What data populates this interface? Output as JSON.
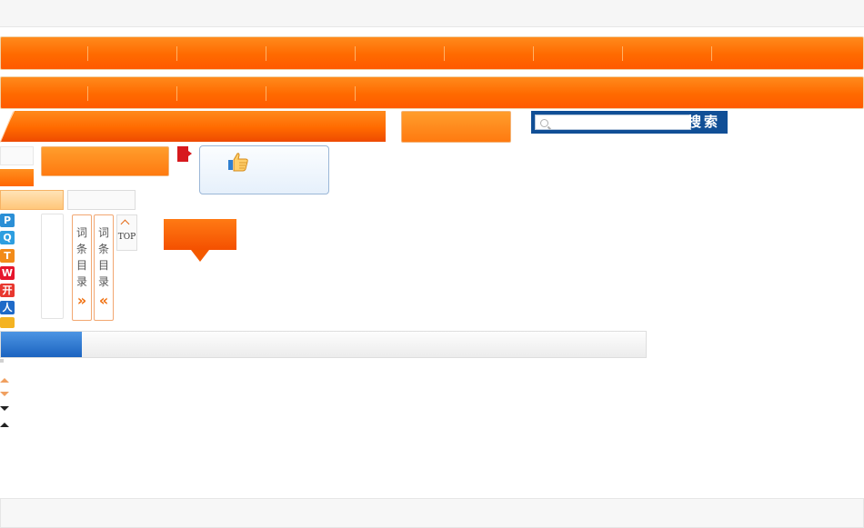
{
  "search": {
    "button_label": "搜索",
    "placeholder": ""
  },
  "toc": {
    "label_a": "词条目录",
    "label_b": "词条目录",
    "arrow_right": "»",
    "arrow_left": "«"
  },
  "back_to_top": {
    "label": "TOP"
  },
  "share": {
    "icons": [
      "pinterest-icon",
      "qq-icon",
      "tencent-weibo-icon",
      "sina-weibo-icon",
      "kaixin-icon",
      "renren-icon",
      "misc-share-icon"
    ]
  },
  "progress": {
    "value_fraction": 0.125
  },
  "colors": {
    "accent_orange": "#ff6a00",
    "search_blue": "#114f96",
    "progress_blue": "#1b63c0",
    "flag_red": "#d7191e"
  }
}
